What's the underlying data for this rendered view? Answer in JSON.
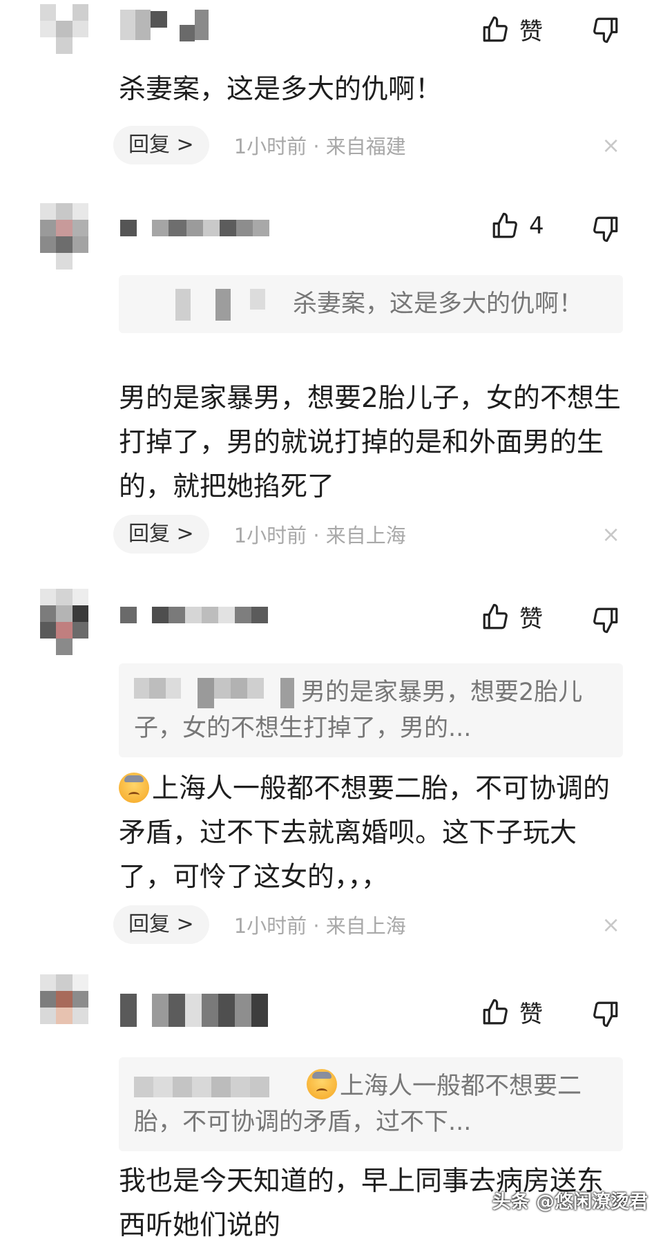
{
  "like_label": "赞",
  "reply_label": "回复 >",
  "close_glyph": "×",
  "comments": [
    {
      "like_text": "赞",
      "text": "杀妻案，这是多大的仇啊！",
      "meta": "1小时前 · 来自福建"
    },
    {
      "like_text": "4",
      "quote": "杀妻案，这是多大的仇啊！",
      "text": "男的是家暴男，想要2胎儿子，女的不想生打掉了，男的就说打掉的是和外面男的生的，就把她掐死了",
      "meta": "1小时前 · 来自上海"
    },
    {
      "like_text": "赞",
      "quote": "男的是家暴男，想要2胎儿子，女的不想生打掉了，男的...",
      "text": "上海人一般都不想要二胎，不可协调的矛盾，过不下去就离婚呗。这下子玩大了，可怜了这女的，，，",
      "meta": "1小时前 · 来自上海"
    },
    {
      "like_text": "赞",
      "quote": "上海人一般都不想要二胎，不可协调的矛盾，过不下...",
      "text": "我也是今天知道的，早上同事去病房送东西听她们说的"
    }
  ],
  "watermark": "头条 @悠闲潦烫君",
  "icons": {
    "like": "thumbs-up-icon",
    "dislike": "thumbs-down-icon",
    "emoji": "sad-sweat-emoji-icon"
  }
}
